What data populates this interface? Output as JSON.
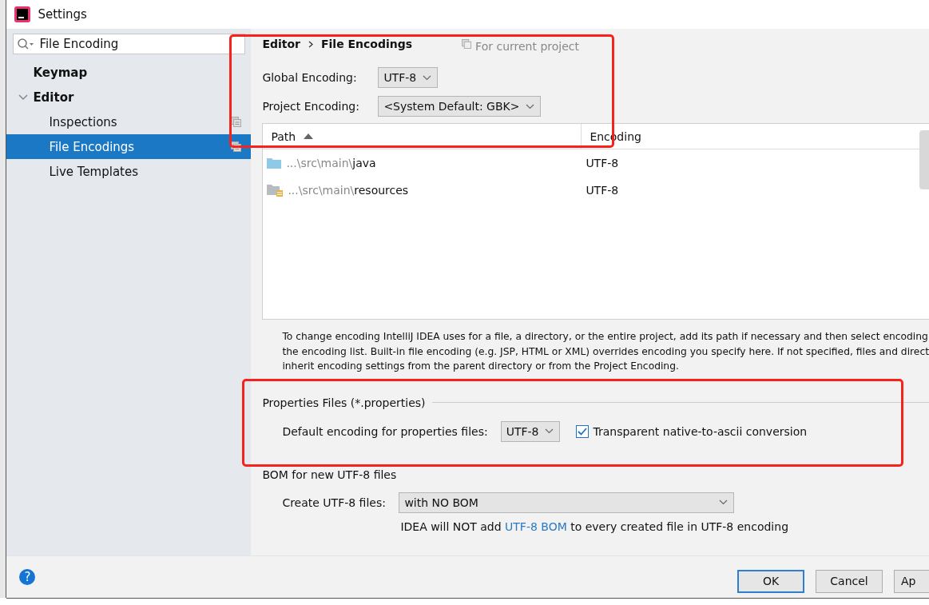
{
  "window": {
    "title": "Settings"
  },
  "search": {
    "value": "File Encoding"
  },
  "sidebar": {
    "items": [
      {
        "label": "Keymap",
        "selected": false,
        "bold": true,
        "shared": false
      },
      {
        "label": "Editor",
        "selected": false,
        "bold": true,
        "shared": false,
        "expanded": true,
        "children": [
          {
            "label": "Inspections",
            "selected": false,
            "shared": true
          },
          {
            "label": "File Encodings",
            "selected": true,
            "shared": true
          },
          {
            "label": "Live Templates",
            "selected": false,
            "shared": false
          }
        ]
      }
    ]
  },
  "breadcrumb": [
    "Editor",
    "File Encodings"
  ],
  "scope_note": "For current project",
  "global_encoding": {
    "label": "Global Encoding:",
    "value": "UTF-8"
  },
  "project_encoding": {
    "label": "Project Encoding:",
    "value": "<System Default: GBK>"
  },
  "table": {
    "columns": [
      "Path",
      "Encoding"
    ],
    "rows": [
      {
        "kind": "source",
        "prefix": "...\\src\\main\\",
        "name": "java",
        "encoding": "UTF-8"
      },
      {
        "kind": "resources",
        "prefix": "...\\src\\main\\",
        "name": "resources",
        "encoding": "UTF-8"
      }
    ]
  },
  "description": [
    "To change encoding IntelliJ IDEA uses for a file, a directory, or the entire project, add its path if necessary and then select encoding",
    "the encoding list. Built-in file encoding (e.g. JSP, HTML or XML) overrides encoding you specify here. If not specified, files and direct",
    "inherit encoding settings from the parent directory or from the Project Encoding."
  ],
  "properties": {
    "title": "Properties Files (*.properties)",
    "label": "Default encoding for properties files:",
    "value": "UTF-8",
    "checkbox": {
      "label": "Transparent native-to-ascii conversion",
      "checked": true
    }
  },
  "bom": {
    "title": "BOM for new UTF-8 files",
    "label": "Create UTF-8 files:",
    "value": "with NO BOM",
    "note_before": "IDEA will NOT add ",
    "note_link": "UTF-8 BOM",
    "note_after": " to every created file in UTF-8 encoding"
  },
  "help_button": "?",
  "buttons": [
    {
      "label": "OK",
      "default": true
    },
    {
      "label": "Cancel",
      "default": false
    },
    {
      "label": "Ap",
      "default": false
    }
  ]
}
